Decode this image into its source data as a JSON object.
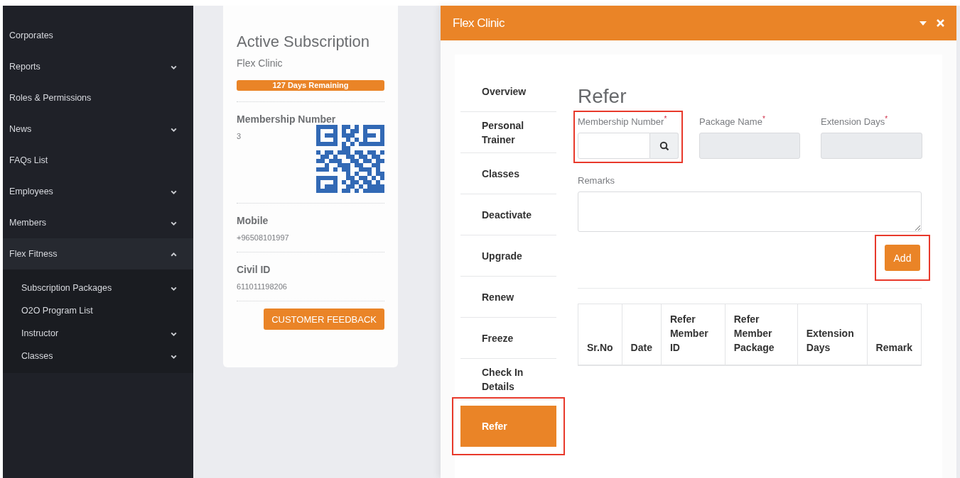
{
  "sidebar": {
    "items": [
      {
        "label": "Corporates",
        "expandable": false
      },
      {
        "label": "Reports",
        "expandable": true,
        "expanded": false
      },
      {
        "label": "Roles & Permissions",
        "expandable": false
      },
      {
        "label": "News",
        "expandable": true,
        "expanded": false
      },
      {
        "label": "FAQs List",
        "expandable": false
      },
      {
        "label": "Employees",
        "expandable": true,
        "expanded": false
      },
      {
        "label": "Members",
        "expandable": true,
        "expanded": false
      },
      {
        "label": "Flex Fitness",
        "expandable": true,
        "expanded": true,
        "children": [
          {
            "label": "Subscription Packages",
            "expandable": true,
            "expanded": false
          },
          {
            "label": "O2O Program List",
            "expandable": false
          },
          {
            "label": "Instructor",
            "expandable": true,
            "expanded": false
          },
          {
            "label": "Classes",
            "expandable": true,
            "expanded": false
          }
        ]
      }
    ]
  },
  "subscription_card": {
    "title": "Active Subscription",
    "club": "Flex Clinic",
    "remaining": "127 Days Remaining",
    "fields": [
      {
        "kind": "qr",
        "label": "Membership Number",
        "value": "3"
      },
      {
        "kind": "text",
        "label": "Mobile",
        "value": "+96508101997"
      },
      {
        "kind": "text",
        "label": "Civil ID",
        "value": "611011198206"
      }
    ],
    "button": "CUSTOMER FEEDBACK"
  },
  "modal": {
    "title": "Flex Clinic",
    "tabs": [
      {
        "label": "Overview",
        "selected": false,
        "highlighted": false
      },
      {
        "label": "Personal Trainer",
        "selected": false,
        "highlighted": false
      },
      {
        "label": "Classes",
        "selected": false,
        "highlighted": false
      },
      {
        "label": "Deactivate",
        "selected": false,
        "highlighted": false
      },
      {
        "label": "Upgrade",
        "selected": false,
        "highlighted": false
      },
      {
        "label": "Renew",
        "selected": false,
        "highlighted": false
      },
      {
        "label": "Freeze",
        "selected": false,
        "highlighted": false
      },
      {
        "label": "Check In Details",
        "selected": false,
        "highlighted": false
      },
      {
        "label": "Refer",
        "selected": true,
        "highlighted": true
      }
    ],
    "form": {
      "heading": "Refer",
      "fields": [
        {
          "kind": "search",
          "label": "Membership Number$^{*}$",
          "disabled": false,
          "highlighted": true
        },
        {
          "kind": "text",
          "label": "Package Name$^{*}$",
          "disabled": true,
          "highlighted": false
        },
        {
          "kind": "text",
          "label": "Extension Days$^{*}$",
          "disabled": true,
          "highlighted": false
        }
      ],
      "remarks": {
        "label": "Remarks"
      },
      "add_button": {
        "label": "Add",
        "highlighted": true
      }
    },
    "table": {
      "columns": [
        "Sr.No",
        "Date",
        "Refer Member ID",
        "Refer Member Package",
        "Extension Days",
        "Remark"
      ]
    }
  }
}
